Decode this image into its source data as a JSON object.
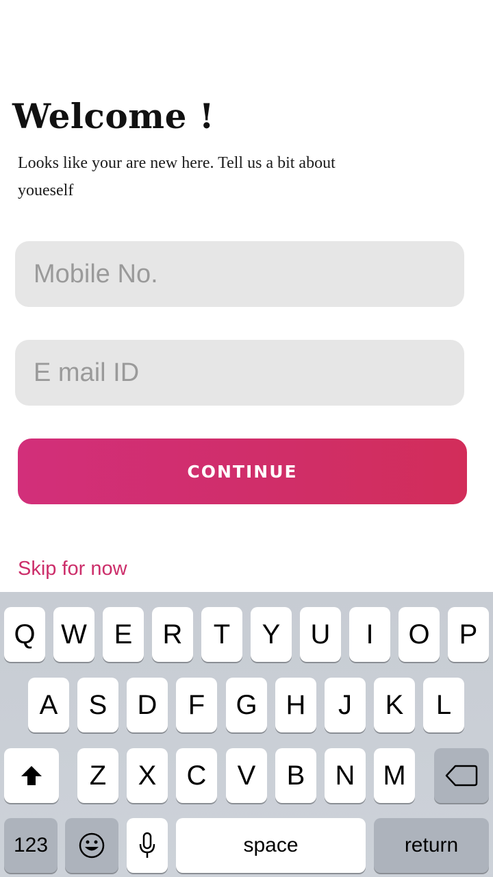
{
  "header": {
    "title": "Welcome !",
    "subtitle": "Looks like your are new here. Tell us a bit about youeself"
  },
  "form": {
    "mobile_placeholder": "Mobile No.",
    "email_placeholder": "E mail ID",
    "continue_label": "CONTINUE",
    "skip_label": "Skip for now"
  },
  "colors": {
    "accent": "#d02e6c",
    "field_background": "#e6e6e6",
    "keyboard_background": "#cbd0d7"
  },
  "keyboard": {
    "row1": [
      "Q",
      "W",
      "E",
      "R",
      "T",
      "Y",
      "U",
      "I",
      "O",
      "P"
    ],
    "row2": [
      "A",
      "S",
      "D",
      "F",
      "G",
      "H",
      "J",
      "K",
      "L"
    ],
    "row3": [
      "Z",
      "X",
      "C",
      "V",
      "B",
      "N",
      "M"
    ],
    "numbers_label": "123",
    "space_label": "space",
    "return_label": "return",
    "icons": {
      "shift": "shift-icon",
      "backspace": "backspace-icon",
      "emoji": "emoji-icon",
      "microphone": "microphone-icon"
    }
  }
}
